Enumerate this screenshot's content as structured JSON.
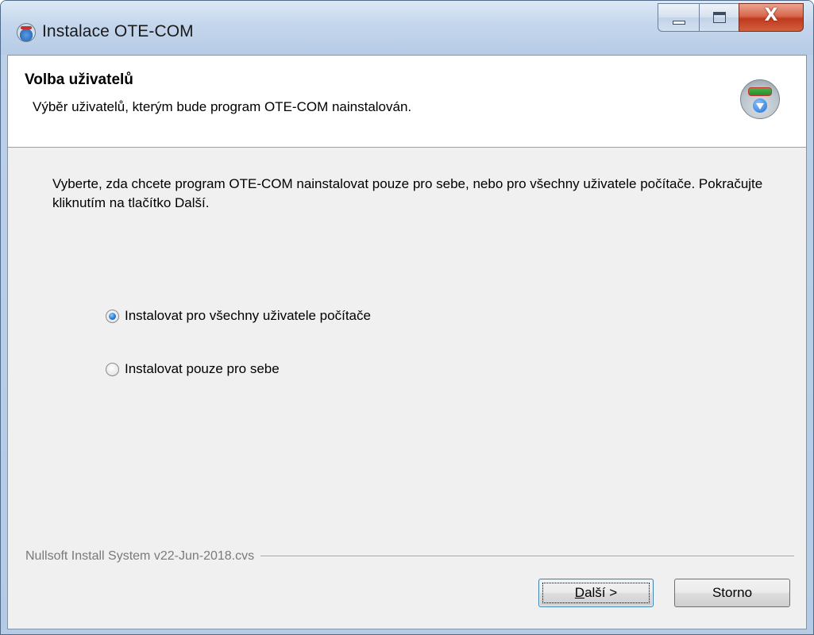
{
  "window": {
    "title": "Instalace OTE-COM",
    "controls": {
      "minimize_icon": "minimize-icon",
      "maximize_icon": "maximize-icon",
      "close_icon": "close-icon",
      "close_glyph": "X"
    }
  },
  "header": {
    "title": "Volba uživatelů",
    "subtitle": "Výběr uživatelů, kterým bude program OTE-COM nainstalován.",
    "icon": "installer-icon"
  },
  "body": {
    "description": "Vyberte, zda chcete program OTE-COM nainstalovat pouze pro sebe, nebo pro všechny uživatele počítače. Pokračujte kliknutím na tlačítko Další.",
    "options": [
      {
        "label": "Instalovat pro všechny uživatele počítače",
        "checked": true
      },
      {
        "label": "Instalovat pouze pro sebe",
        "checked": false
      }
    ]
  },
  "footer": {
    "branding": "Nullsoft Install System v22-Jun-2018.cvs",
    "next_mnemonic": "D",
    "next_rest": "alší >",
    "cancel_label": "Storno"
  },
  "colors": {
    "titlebar": "#c4d6ec",
    "client_bg": "#f0f0f0",
    "header_bg": "#ffffff",
    "close_button": "#c0391d",
    "branding_text": "#7a7a7a"
  }
}
